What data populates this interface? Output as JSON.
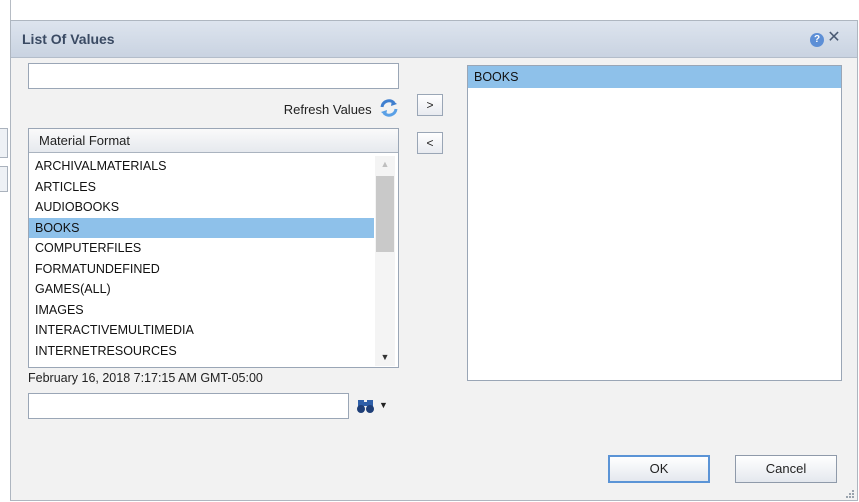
{
  "dialog": {
    "title": "List Of Values",
    "help_icon": "help-icon",
    "close_icon": "close-icon"
  },
  "search": {
    "value": "",
    "placeholder": ""
  },
  "refresh": {
    "label": "Refresh Values",
    "icon": "refresh-icon"
  },
  "list": {
    "header": "Material Format",
    "items": [
      "ARCHIVALMATERIALS",
      "ARTICLES",
      "AUDIOBOOKS",
      "BOOKS",
      "COMPUTERFILES",
      "FORMATUNDEFINED",
      "GAMES(ALL)",
      "IMAGES",
      "INTERACTIVEMULTIMEDIA",
      "INTERNETRESOURCES"
    ],
    "selected_item": "BOOKS"
  },
  "timestamp": "February 16, 2018 7:17:15 AM GMT-05:00",
  "find": {
    "value": "",
    "placeholder": "",
    "icon": "binoculars-icon",
    "menu_icon": "dropdown-arrow-icon"
  },
  "move": {
    "add_label": ">",
    "remove_label": "<"
  },
  "selected_values": [
    "BOOKS"
  ],
  "buttons": {
    "ok": "OK",
    "cancel": "Cancel"
  },
  "colors": {
    "title_text": "#3a4a63",
    "selection": "#8ec1ea",
    "ok_border": "#5b94d6"
  }
}
